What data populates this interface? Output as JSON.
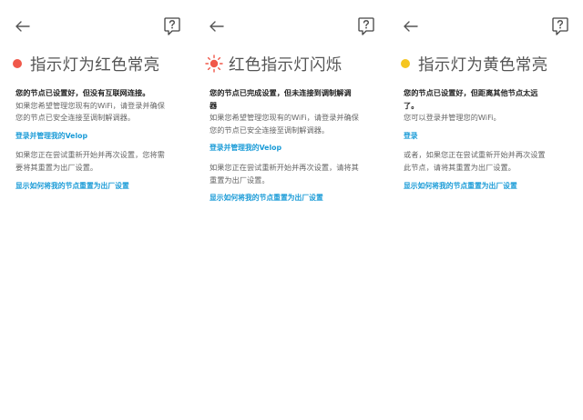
{
  "colors": {
    "red": "#f0584a",
    "yellow": "#f5c51f",
    "link": "#1a9bd7"
  },
  "panels": [
    {
      "indicator": "red-dot",
      "title": "指示灯为红色常亮",
      "heading": "您的节点已设置好，但没有互联网连接。",
      "body_lines": [
        "如果您希望管理您现有的WiFi，请登录并确保",
        "您的节点已安全连接至调制解调器。"
      ],
      "link1": "登录并管理我的Velop",
      "body2_lines": [
        "如果您正在尝试重新开始并再次设置，您将需",
        "要将其重置为出厂设置。"
      ],
      "link2": "显示如何将我的节点重置为出厂设置"
    },
    {
      "indicator": "red-blink-icon",
      "title": "红色指示灯闪烁",
      "heading_lines": [
        "您的节点已完成设置，但未连接到调制解调",
        "器"
      ],
      "body_lines": [
        "如果您希望管理您现有的WiFi，请登录并确保",
        "您的节点已安全连接至调制解调器。"
      ],
      "link1": "登录并管理我的Velop",
      "body2_lines": [
        "如果您正在尝试重新开始并再次设置，请将其",
        "重置为出厂设置。"
      ],
      "link2": "显示如何将我的节点重置为出厂设置"
    },
    {
      "indicator": "yellow-dot",
      "title": "指示灯为黄色常亮",
      "heading_lines": [
        "您的节点已设置好，但距离其他节点太远",
        "了。"
      ],
      "body_lines": [
        "您可以登录并管理您的WiFi。"
      ],
      "link1": "登录",
      "body2_lines": [
        "或者，如果您正在尝试重新开始并再次设置",
        "此节点，请将其重置为出厂设置。"
      ],
      "link2": "显示如何将我的节点重置为出厂设置"
    }
  ]
}
